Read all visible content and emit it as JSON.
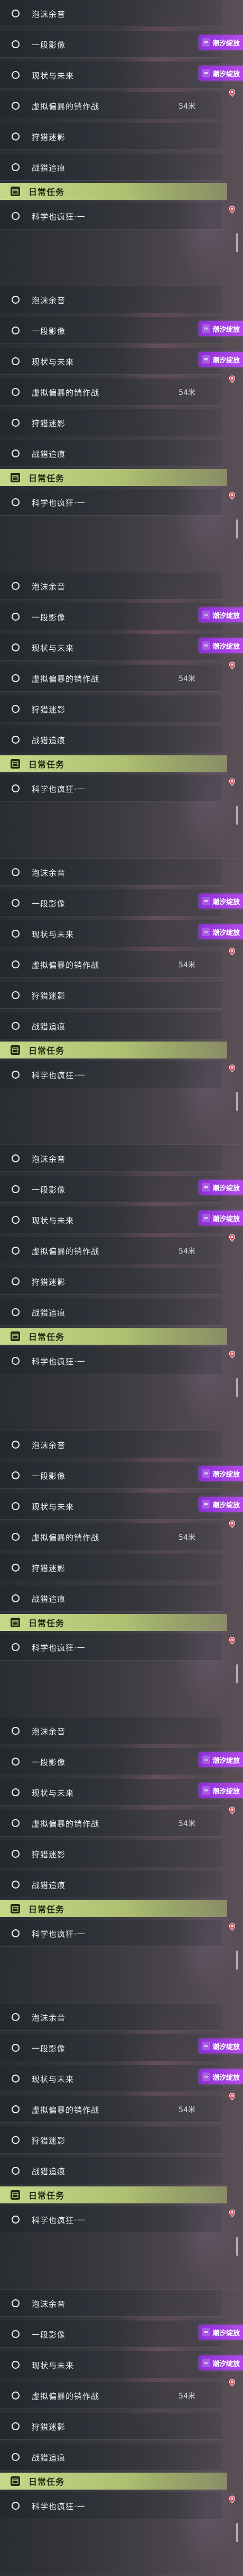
{
  "quest_rows": {
    "r1": {
      "label": "泡沫余音"
    },
    "r2": {
      "label": "一段影像"
    },
    "r3": {
      "label": "现状与未来"
    },
    "r4": {
      "label": "虚拟偏暴的销作战",
      "meta": "54米"
    },
    "r5": {
      "label": "狩猎迷影"
    },
    "r6": {
      "label": "战猎追痕"
    }
  },
  "badge": {
    "label": "潮汐绽放"
  },
  "daily": {
    "header": "日常任务",
    "item": {
      "label": "科学也疯狂·一"
    }
  },
  "colors": {
    "daily_accent": "#c6d98a",
    "badge": "#a63fe0",
    "alert_pin": "#e04b5e"
  }
}
